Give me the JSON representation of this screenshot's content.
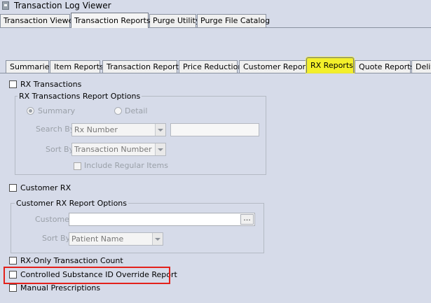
{
  "window": {
    "title": "Transaction Log Viewer"
  },
  "top_tabs": [
    {
      "label": "Transaction Viewer"
    },
    {
      "label": "Transaction Reports",
      "active": true
    },
    {
      "label": "Purge Utility"
    },
    {
      "label": "Purge File Catalog"
    }
  ],
  "sub_tabs": [
    {
      "label": "Summaries"
    },
    {
      "label": "Item Reports"
    },
    {
      "label": "Transaction Reports"
    },
    {
      "label": "Price Reduction"
    },
    {
      "label": "Customer Reports"
    },
    {
      "label": "RX Reports",
      "active": true
    },
    {
      "label": "Quote Reports"
    },
    {
      "label": "Deliv"
    }
  ],
  "rx_transactions": {
    "label": "RX Transactions",
    "checked": false,
    "options_title": "RX Transactions Report Options",
    "summary_label": "Summary",
    "detail_label": "Detail",
    "search_by_label": "Search By",
    "search_by_value": "Rx Number",
    "search_value": "",
    "sort_by_label": "Sort By",
    "sort_by_value": "Transaction Number",
    "include_regular_label": "Include Regular Items"
  },
  "customer_rx": {
    "label": "Customer RX",
    "checked": false,
    "options_title": "Customer RX Report Options",
    "customer_label": "Customer",
    "customer_value": "",
    "lookup_button": "...",
    "sort_by_label": "Sort By",
    "sort_by_value": "Patient Name"
  },
  "rx_only_count": {
    "label": "RX-Only Transaction Count",
    "checked": false
  },
  "controlled_substance": {
    "label": "Controlled Substance ID Override Report",
    "checked": false
  },
  "manual_prescriptions": {
    "label": "Manual Prescriptions",
    "checked": false
  },
  "colors": {
    "active_subtab": "#f3ef2a",
    "highlight_border": "#e3211b",
    "background": "#d6dbe9"
  }
}
